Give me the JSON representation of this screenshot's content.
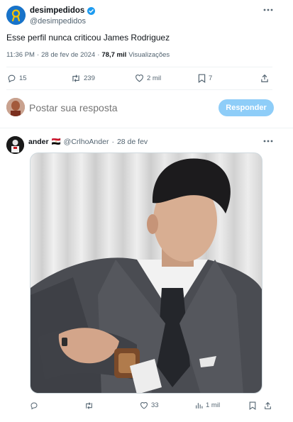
{
  "tweet": {
    "author_name": "desimpedidos",
    "author_handle": "@desimpedidos",
    "text": "Esse perfil nunca criticou James Rodriguez",
    "time": "11:36 PM",
    "date": "28 de fev de 2024",
    "views_count": "78,7 mil",
    "views_label": "Visualizações",
    "replies": "15",
    "retweets": "239",
    "likes": "2 mil",
    "bookmarks": "7"
  },
  "composer": {
    "placeholder": "Postar sua resposta",
    "button_label": "Responder"
  },
  "reply": {
    "author_name": "ander",
    "flag": "🇪🇬",
    "author_handle": "@CrlhoAnder",
    "separator": "·",
    "date": "28 de fev",
    "likes": "33",
    "views": "1 mil"
  },
  "colors": {
    "accent": "#1d9bf0",
    "button_disabled": "#8ecdf8",
    "verified": "#1d9bf0",
    "brand_yellow": "#f5c400"
  }
}
